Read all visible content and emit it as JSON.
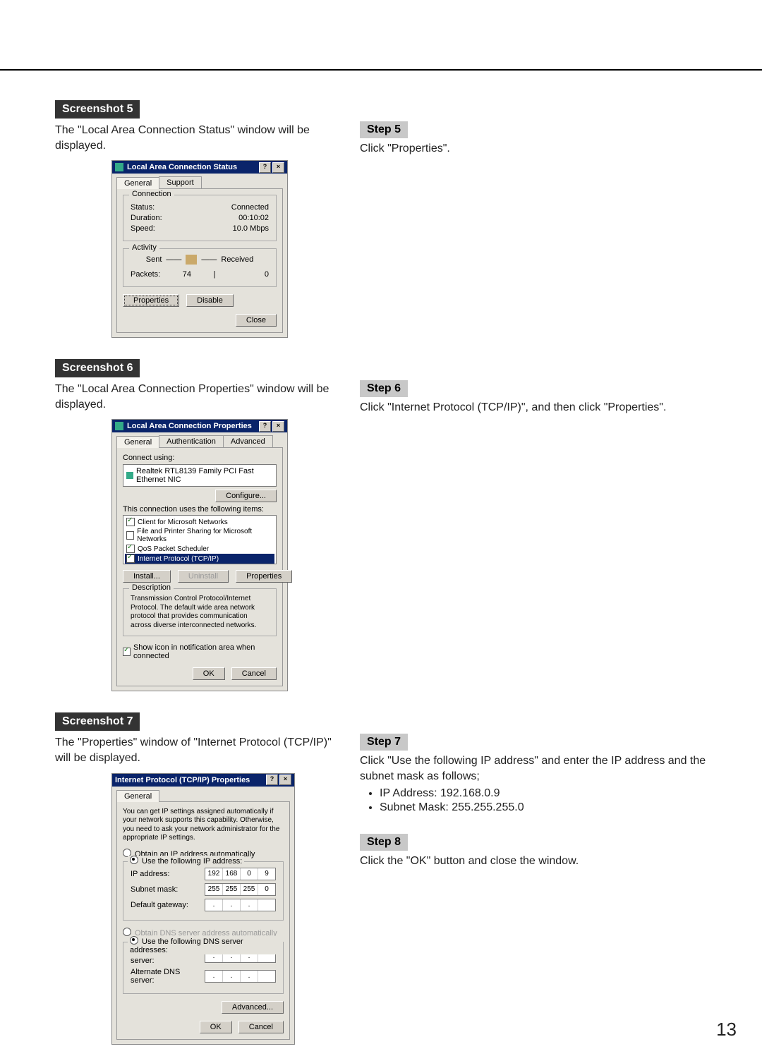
{
  "page_number": "13",
  "sections": {
    "s5": {
      "badge": "Screenshot 5",
      "desc": "The \"Local Area Connection Status\" window will be displayed.",
      "step_badge": "Step 5",
      "step_text": "Click \"Properties\"."
    },
    "s6": {
      "badge": "Screenshot 6",
      "desc": "The \"Local Area Connection Properties\" window will be displayed.",
      "step_badge": "Step 6",
      "step_text": "Click \"Internet Protocol (TCP/IP)\", and then click \"Properties\"."
    },
    "s7": {
      "badge": "Screenshot 7",
      "desc": "The \"Properties\" window of \"Internet Protocol (TCP/IP)\" will be displayed.",
      "step_badge": "Step 7",
      "step_text": "Click \"Use the following IP address\" and enter the IP address and the subnet mask as follows;",
      "bullet_ip": "IP Address: 192.168.0.9",
      "bullet_mask": "Subnet Mask: 255.255.255.0"
    },
    "s8": {
      "step_badge": "Step 8",
      "step_text": "Click the \"OK\" button and close the window."
    }
  },
  "dlg_status": {
    "title": "Local Area Connection Status",
    "tab_general": "General",
    "tab_support": "Support",
    "grp_conn": "Connection",
    "lbl_status": "Status:",
    "val_status": "Connected",
    "lbl_duration": "Duration:",
    "val_duration": "00:10:02",
    "lbl_speed": "Speed:",
    "val_speed": "10.0 Mbps",
    "grp_activity": "Activity",
    "lbl_sent": "Sent",
    "lbl_received": "Received",
    "lbl_packets": "Packets:",
    "val_sent": "74",
    "val_recv": "0",
    "btn_properties": "Properties",
    "btn_disable": "Disable",
    "btn_close": "Close"
  },
  "dlg_props": {
    "title": "Local Area Connection Properties",
    "tab_general": "General",
    "tab_auth": "Authentication",
    "tab_adv": "Advanced",
    "lbl_connect_using": "Connect using:",
    "nic": "Realtek RTL8139 Family PCI Fast Ethernet NIC",
    "btn_configure": "Configure...",
    "lbl_items": "This connection uses the following items:",
    "item1": "Client for Microsoft Networks",
    "item2": "File and Printer Sharing for Microsoft Networks",
    "item3": "QoS Packet Scheduler",
    "item4": "Internet Protocol (TCP/IP)",
    "btn_install": "Install...",
    "btn_uninstall": "Uninstall",
    "btn_properties": "Properties",
    "grp_desc": "Description",
    "desc_text": "Transmission Control Protocol/Internet Protocol. The default wide area network protocol that provides communication across diverse interconnected networks.",
    "chk_show": "Show icon in notification area when connected",
    "btn_ok": "OK",
    "btn_cancel": "Cancel"
  },
  "dlg_tcp": {
    "title": "Internet Protocol (TCP/IP) Properties",
    "tab_general": "General",
    "intro": "You can get IP settings assigned automatically if your network supports this capability. Otherwise, you need to ask your network administrator for the appropriate IP settings.",
    "r_auto": "Obtain an IP address automatically",
    "r_manual": "Use the following IP address:",
    "lbl_ip": "IP address:",
    "lbl_mask": "Subnet mask:",
    "lbl_gw": "Default gateway:",
    "r_dns_auto": "Obtain DNS server address automatically",
    "r_dns_manual": "Use the following DNS server addresses:",
    "lbl_pref_dns": "Preferred DNS server:",
    "lbl_alt_dns": "Alternate DNS server:",
    "ip": [
      "192",
      "168",
      "0",
      "9"
    ],
    "mask": [
      "255",
      "255",
      "255",
      "0"
    ],
    "btn_adv": "Advanced...",
    "btn_ok": "OK",
    "btn_cancel": "Cancel"
  }
}
